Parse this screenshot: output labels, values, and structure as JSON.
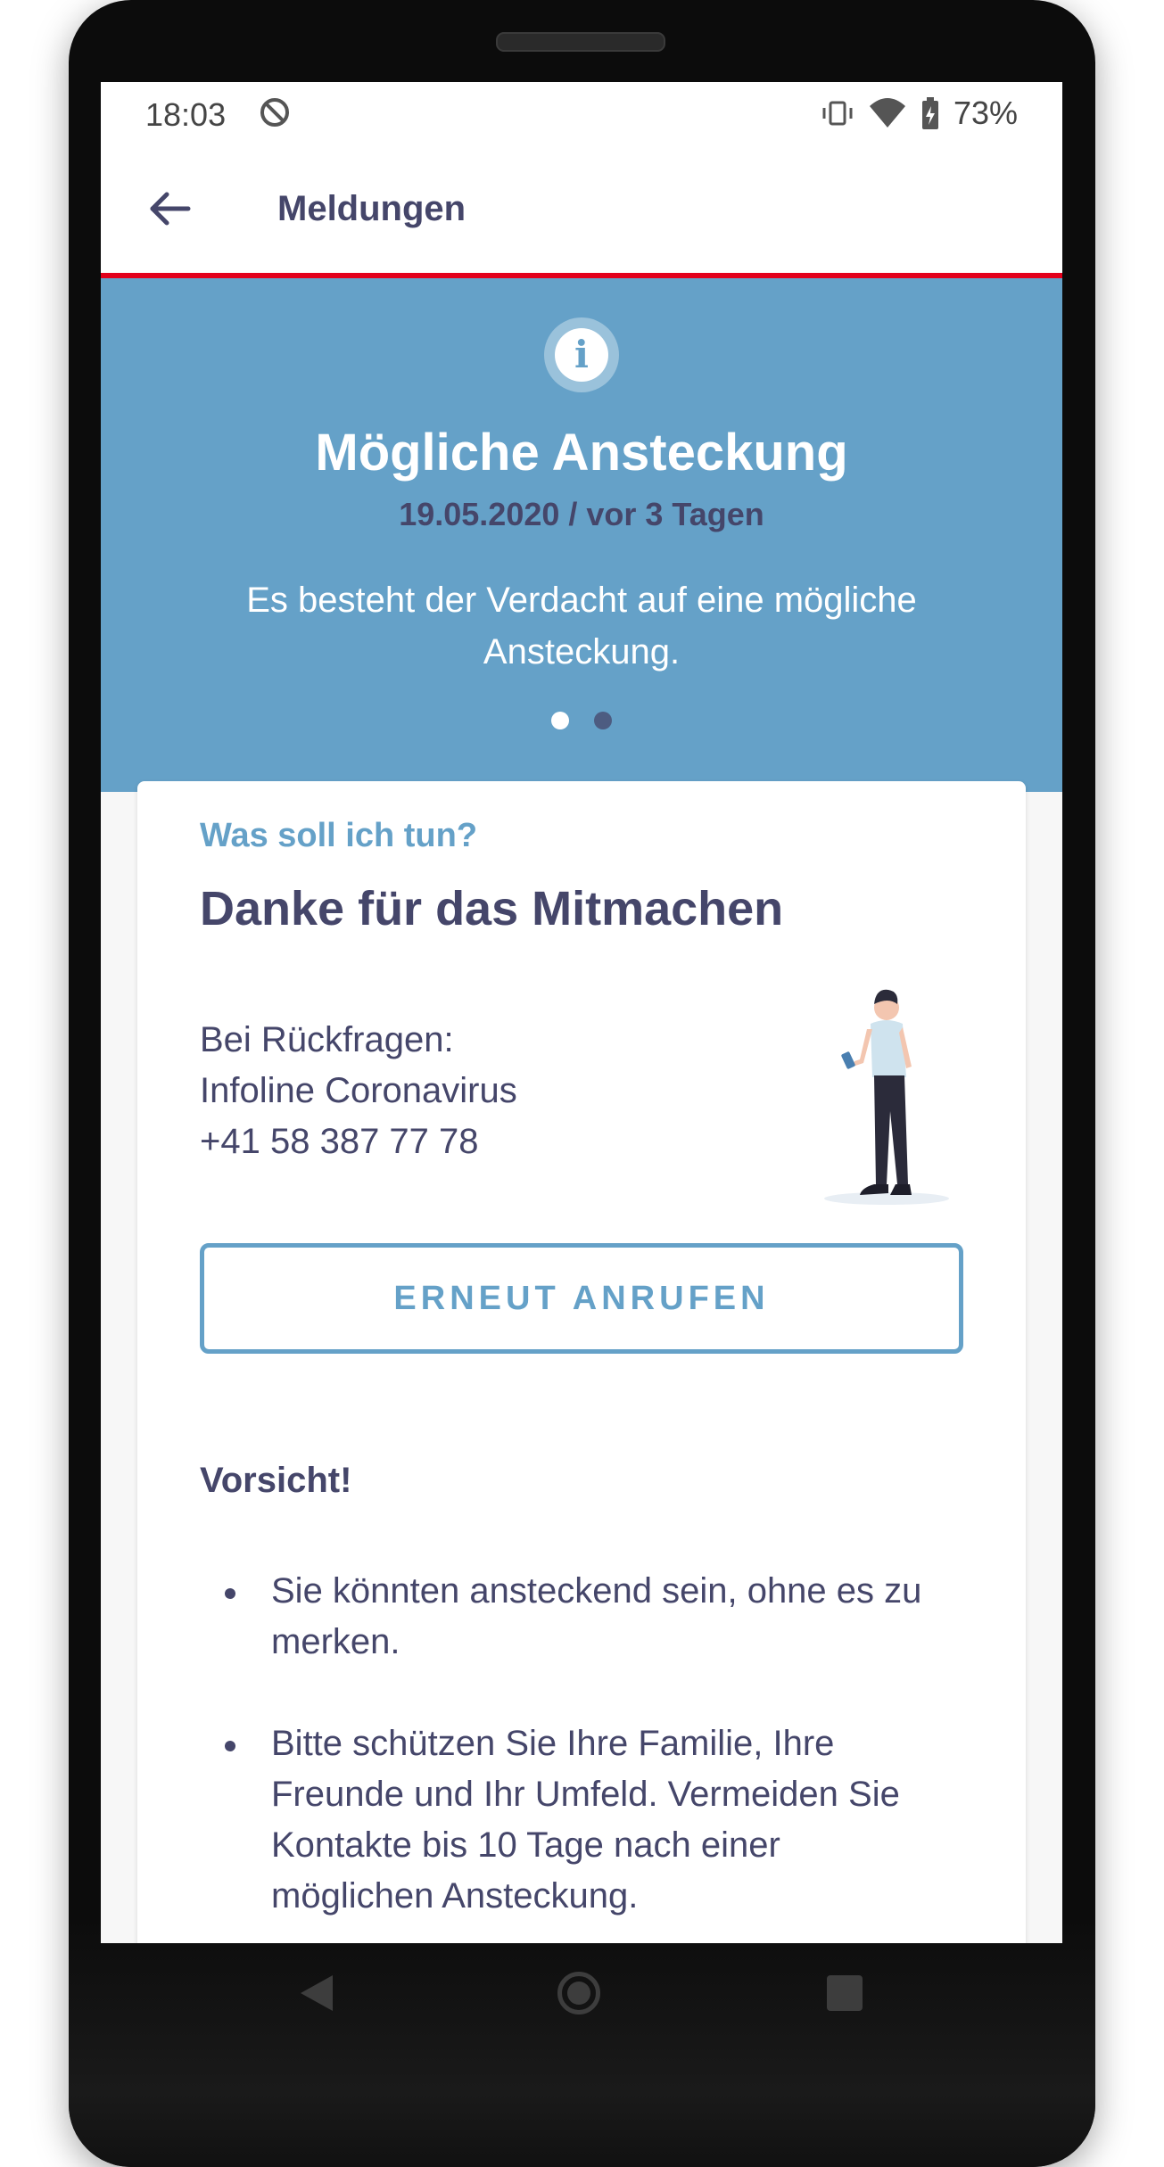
{
  "status_bar": {
    "time": "18:03",
    "battery_percent": "73%",
    "icons": [
      "do-not-disturb-icon",
      "vibrate-icon",
      "wifi-icon",
      "battery-charging-icon"
    ]
  },
  "app_bar": {
    "title": "Meldungen",
    "back_icon": "arrow-left-icon",
    "accent_line_color": "#e3001b"
  },
  "hero": {
    "icon": "info-icon",
    "title": "Mögliche Ansteckung",
    "date": "19.05.2020 / vor 3 Tagen",
    "text": "Es besteht der Verdacht auf eine mögliche Ansteckung.",
    "pager": {
      "pages": 2,
      "active": 1
    },
    "background_color": "#65a1c8"
  },
  "card": {
    "kicker": "Was soll ich tun?",
    "title": "Danke für das Mitmachen",
    "contact": {
      "line1": "Bei Rückfragen:",
      "line2": "Infoline Coronavirus",
      "phone": "+41 58 387 77 78"
    },
    "illustration": "person-with-phone-illustration",
    "call_button": "ERNEUT ANRUFEN",
    "caution_title": "Vorsicht!",
    "bullets": [
      "Sie könnten ansteckend sein, ohne es zu merken.",
      "Bitte schützen Sie Ihre Familie, Ihre Freunde und Ihr Umfeld. Vermeiden Sie Kontakte bis 10 Tage nach einer möglichen Ansteckung."
    ]
  },
  "nav_bar": {
    "icons": [
      "nav-back-icon",
      "nav-home-icon",
      "nav-recents-icon"
    ]
  }
}
